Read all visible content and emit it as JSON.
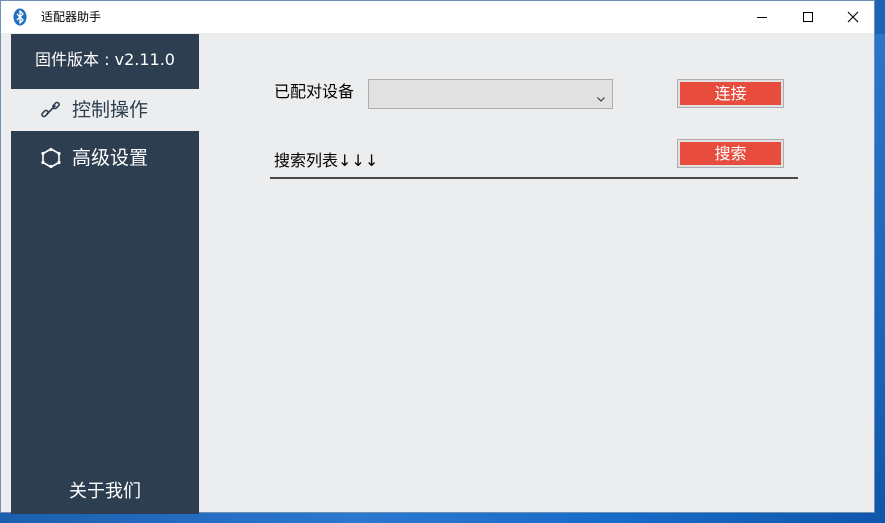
{
  "window": {
    "title": "适配器助手",
    "icon": "bluetooth-icon",
    "controls": {
      "minimize": "minimize-icon",
      "maximize": "maximize-icon",
      "close": "close-icon"
    }
  },
  "sidebar": {
    "firmware_version": "固件版本 : v2.11.0",
    "items": [
      {
        "label": "控制操作",
        "icon": "link-icon",
        "active": true
      },
      {
        "label": "高级设置",
        "icon": "hexagon-settings-icon",
        "active": false
      }
    ],
    "about": "关于我们"
  },
  "main": {
    "paired_label": "已配对设备",
    "device_select": {
      "value": ""
    },
    "connect_label": "连接",
    "search_label": "搜索",
    "search_list_label": "搜索列表↓↓↓"
  },
  "colors": {
    "sidebar_bg": "#2c3e50",
    "content_bg": "#ecedee",
    "button_red": "#e74c3c",
    "accent_blue": "#1f63b6"
  }
}
